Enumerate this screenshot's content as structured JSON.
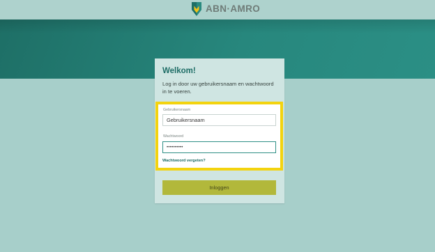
{
  "brand": {
    "name": "ABN·AMRO",
    "logo_icon": "abn-amro-shield-icon",
    "colors": {
      "green": "#1e6f66",
      "yellow": "#f3c318",
      "accent_button": "#b2b83b",
      "highlight": "#f3d30e"
    }
  },
  "login": {
    "title": "Welkom!",
    "intro": "Log in door uw gebruikersnaam en wachtwoord in te voeren.",
    "username": {
      "label": "Gebruikersnaam",
      "value": "Gebruikersnaam"
    },
    "password": {
      "label": "Wachtwoord",
      "value": "••••••••••"
    },
    "forgot_link": "Wachtwoord vergeten?",
    "submit_label": "Inloggen"
  }
}
